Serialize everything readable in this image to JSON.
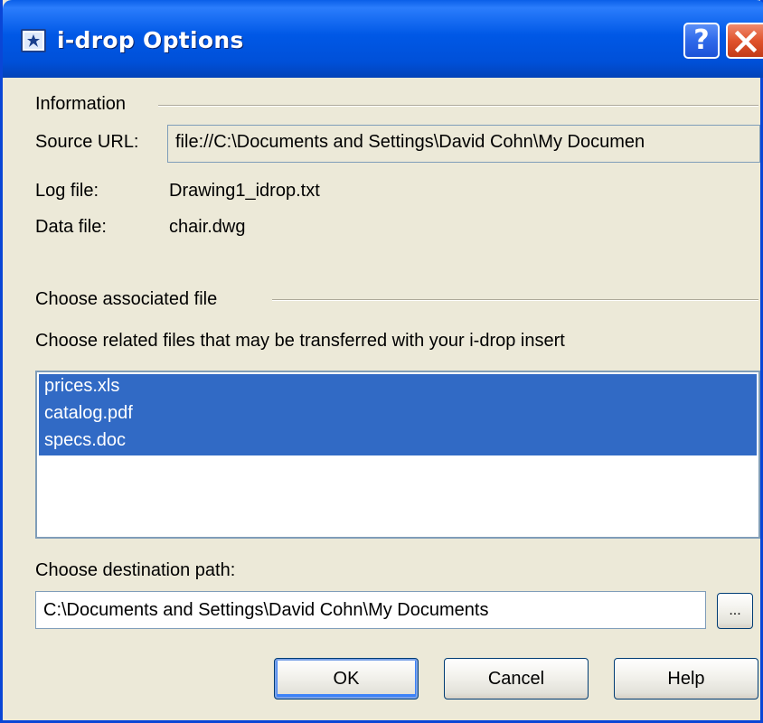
{
  "window": {
    "title": "i-drop Options",
    "help_label": "?",
    "icons": {
      "app": "idrop-app-icon",
      "help": "question-icon",
      "close": "close-icon"
    },
    "colors": {
      "titlebar": "#0058e6",
      "close_button": "#e0532d",
      "selection": "#316ac5",
      "dialog_bg": "#ece9d8"
    }
  },
  "information": {
    "group_label": "Information",
    "source_url_label": "Source URL:",
    "source_url_value": "file://C:\\Documents and Settings\\David Cohn\\My Documen",
    "log_file_label": "Log file:",
    "log_file_value": "Drawing1_idrop.txt",
    "data_file_label": "Data file:",
    "data_file_value": "chair.dwg"
  },
  "associated": {
    "group_label": "Choose associated file",
    "instruction": "Choose related files that may be transferred with  your i-drop insert",
    "files": [
      {
        "name": "prices.xls",
        "selected": true
      },
      {
        "name": "catalog.pdf",
        "selected": true
      },
      {
        "name": "specs.doc",
        "selected": true
      }
    ]
  },
  "destination": {
    "label": "Choose destination path:",
    "path_value": "C:\\Documents and Settings\\David Cohn\\My Documents",
    "browse_label": "..."
  },
  "buttons": {
    "ok": "OK",
    "cancel": "Cancel",
    "help": "Help"
  }
}
